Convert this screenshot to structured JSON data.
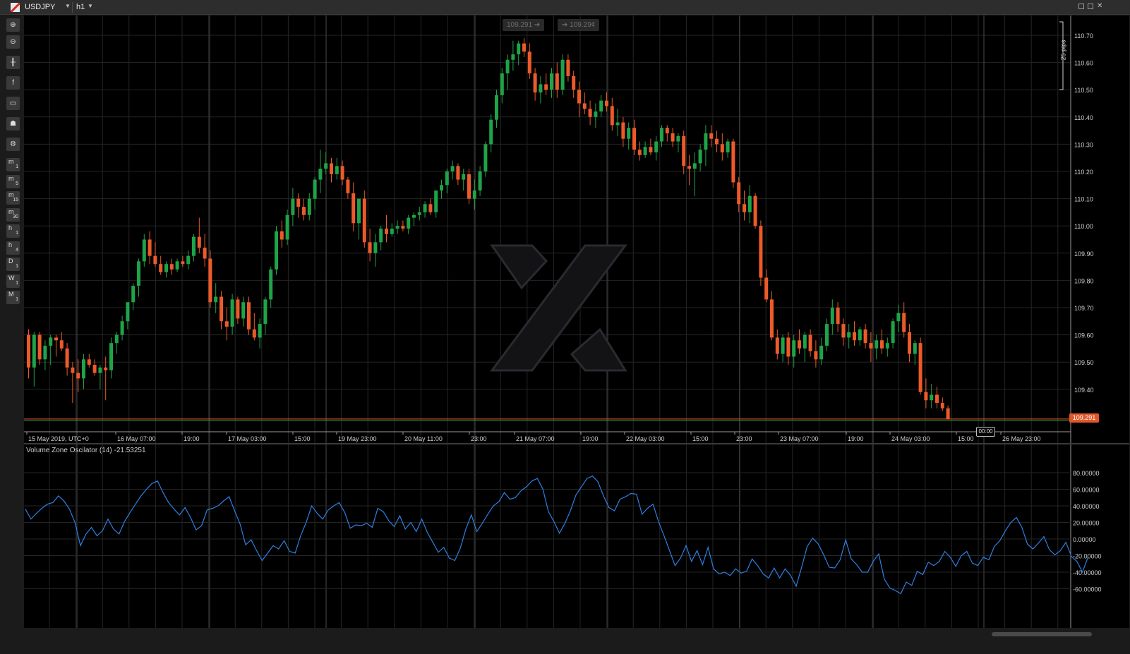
{
  "window": {
    "symbol": "USDJPY",
    "timeframe": "h1"
  },
  "toolbar": {
    "tools": [
      "zoom-in-icon",
      "zoom-out-icon",
      "chart-type-icon",
      "facebook-icon",
      "robot-icon",
      "profile-icon",
      "settings-icon"
    ],
    "timeframes": [
      {
        "l": "m",
        "s": "1"
      },
      {
        "l": "m",
        "s": "5"
      },
      {
        "l": "m",
        "s": "15"
      },
      {
        "l": "m",
        "s": "30"
      },
      {
        "l": "h",
        "s": "1"
      },
      {
        "l": "h",
        "s": "4"
      },
      {
        "l": "D",
        "s": "1"
      },
      {
        "l": "W",
        "s": "1"
      },
      {
        "l": "M",
        "s": "1"
      }
    ]
  },
  "quote": {
    "sell": "109.291",
    "buy": "109.29¢"
  },
  "chart_data": {
    "type": "candlestick",
    "price_axis": [
      "110.70",
      "110.60",
      "110.50",
      "110.40",
      "110.30",
      "110.20",
      "110.10",
      "110.00",
      "109.90",
      "109.80",
      "109.70",
      "109.60",
      "109.50",
      "109.40"
    ],
    "time_axis": [
      "15 May 2019, UTC+0",
      "16 May 07:00",
      "19:00",
      "17 May 03:00",
      "15:00",
      "19 May 23:00",
      "20 May 11:00",
      "23:00",
      "21 May 07:00",
      "19:00",
      "22 May 03:00",
      "15:00",
      "23:00",
      "23 May 07:00",
      "19:00",
      "24 May 03:00",
      "15:00",
      "26 May 23:00"
    ],
    "current_price": "109.291",
    "current_time": "00:00",
    "pips_label": "25 pips",
    "colors": {
      "up": "#1fa348",
      "down": "#ec5a2a",
      "grid": "#252525",
      "osc": "#2e7fe0"
    },
    "ohlc": [
      [
        109.6,
        109.62,
        109.44,
        109.48
      ],
      [
        109.48,
        109.61,
        109.41,
        109.6
      ],
      [
        109.6,
        109.61,
        109.49,
        109.51
      ],
      [
        109.51,
        109.58,
        109.47,
        109.56
      ],
      [
        109.56,
        109.6,
        109.49,
        109.59
      ],
      [
        109.59,
        109.6,
        109.52,
        109.58
      ],
      [
        109.58,
        109.61,
        109.54,
        109.55
      ],
      [
        109.55,
        109.57,
        109.45,
        109.48
      ],
      [
        109.48,
        109.5,
        109.35,
        109.46
      ],
      [
        109.46,
        109.51,
        109.39,
        109.44
      ],
      [
        109.44,
        109.53,
        109.4,
        109.51
      ],
      [
        109.51,
        109.53,
        109.48,
        109.49
      ],
      [
        109.49,
        109.51,
        109.45,
        109.46
      ],
      [
        109.46,
        109.49,
        109.4,
        109.48
      ],
      [
        109.48,
        109.52,
        109.36,
        109.47
      ],
      [
        109.47,
        109.59,
        109.44,
        109.57
      ],
      [
        109.57,
        109.61,
        109.53,
        109.6
      ],
      [
        109.6,
        109.67,
        109.58,
        109.65
      ],
      [
        109.65,
        109.72,
        109.62,
        109.72
      ],
      [
        109.72,
        109.79,
        109.69,
        109.78
      ],
      [
        109.78,
        109.88,
        109.74,
        109.87
      ],
      [
        109.87,
        109.97,
        109.85,
        109.95
      ],
      [
        109.95,
        109.98,
        109.86,
        109.89
      ],
      [
        109.89,
        109.94,
        109.85,
        109.86
      ],
      [
        109.86,
        109.89,
        109.82,
        109.83
      ],
      [
        109.83,
        109.87,
        109.81,
        109.86
      ],
      [
        109.86,
        109.88,
        109.82,
        109.84
      ],
      [
        109.84,
        109.88,
        109.83,
        109.87
      ],
      [
        109.87,
        109.89,
        109.85,
        109.86
      ],
      [
        109.86,
        109.91,
        109.84,
        109.89
      ],
      [
        109.89,
        109.97,
        109.87,
        109.96
      ],
      [
        109.96,
        110.03,
        109.9,
        109.92
      ],
      [
        109.92,
        109.97,
        109.85,
        109.88
      ],
      [
        109.88,
        109.91,
        109.7,
        109.72
      ],
      [
        109.72,
        109.79,
        109.68,
        109.74
      ],
      [
        109.74,
        109.76,
        109.62,
        109.65
      ],
      [
        109.65,
        109.7,
        109.58,
        109.63
      ],
      [
        109.63,
        109.75,
        109.6,
        109.73
      ],
      [
        109.73,
        109.74,
        109.64,
        109.66
      ],
      [
        109.66,
        109.74,
        109.63,
        109.72
      ],
      [
        109.72,
        109.74,
        109.6,
        109.62
      ],
      [
        109.62,
        109.68,
        109.58,
        109.59
      ],
      [
        109.59,
        109.66,
        109.55,
        109.64
      ],
      [
        109.64,
        109.74,
        109.6,
        109.73
      ],
      [
        109.73,
        109.85,
        109.7,
        109.84
      ],
      [
        109.84,
        110.0,
        109.82,
        109.98
      ],
      [
        109.98,
        110.02,
        109.92,
        109.95
      ],
      [
        109.95,
        110.06,
        109.93,
        110.04
      ],
      [
        110.04,
        110.14,
        110.0,
        110.1
      ],
      [
        110.1,
        110.12,
        110.03,
        110.07
      ],
      [
        110.07,
        110.1,
        110.02,
        110.04
      ],
      [
        110.04,
        110.12,
        110.02,
        110.1
      ],
      [
        110.1,
        110.18,
        110.06,
        110.17
      ],
      [
        110.17,
        110.28,
        110.12,
        110.21
      ],
      [
        110.21,
        110.27,
        110.19,
        110.23
      ],
      [
        110.23,
        110.25,
        110.16,
        110.19
      ],
      [
        110.19,
        110.25,
        110.17,
        110.22
      ],
      [
        110.22,
        110.24,
        110.15,
        110.17
      ],
      [
        110.17,
        110.18,
        110.1,
        110.12
      ],
      [
        110.12,
        110.16,
        109.98,
        110.01
      ],
      [
        110.01,
        110.07,
        109.95,
        110.1
      ],
      [
        110.1,
        110.13,
        109.92,
        109.94
      ],
      [
        109.94,
        109.99,
        109.87,
        109.9
      ],
      [
        109.9,
        109.97,
        109.85,
        109.94
      ],
      [
        109.94,
        110.0,
        109.91,
        109.99
      ],
      [
        109.99,
        110.04,
        109.94,
        109.97
      ],
      [
        109.97,
        110.01,
        109.96,
        109.99
      ],
      [
        109.99,
        110.02,
        109.97,
        110.0
      ],
      [
        110.0,
        110.02,
        109.98,
        109.99
      ],
      [
        109.99,
        110.04,
        109.97,
        110.03
      ],
      [
        110.03,
        110.05,
        110.0,
        110.04
      ],
      [
        110.04,
        110.07,
        110.02,
        110.05
      ],
      [
        110.05,
        110.09,
        110.03,
        110.08
      ],
      [
        110.08,
        110.1,
        110.04,
        110.05
      ],
      [
        110.05,
        110.13,
        110.03,
        110.13
      ],
      [
        110.13,
        110.17,
        110.1,
        110.15
      ],
      [
        110.15,
        110.21,
        110.12,
        110.2
      ],
      [
        110.2,
        110.24,
        110.17,
        110.22
      ],
      [
        110.22,
        110.23,
        110.15,
        110.17
      ],
      [
        110.17,
        110.21,
        110.13,
        110.19
      ],
      [
        110.19,
        110.21,
        110.08,
        110.1
      ],
      [
        110.1,
        110.17,
        110.06,
        110.13
      ],
      [
        110.13,
        110.22,
        110.11,
        110.2
      ],
      [
        110.2,
        110.31,
        110.18,
        110.3
      ],
      [
        110.3,
        110.41,
        110.27,
        110.39
      ],
      [
        110.39,
        110.5,
        110.36,
        110.48
      ],
      [
        110.48,
        110.58,
        110.45,
        110.56
      ],
      [
        110.56,
        110.63,
        110.5,
        110.61
      ],
      [
        110.61,
        110.68,
        110.57,
        110.63
      ],
      [
        110.63,
        110.68,
        110.59,
        110.67
      ],
      [
        110.67,
        110.69,
        110.62,
        110.64
      ],
      [
        110.64,
        110.67,
        110.54,
        110.56
      ],
      [
        110.56,
        110.58,
        110.46,
        110.49
      ],
      [
        110.49,
        110.55,
        110.45,
        110.52
      ],
      [
        110.52,
        110.56,
        110.48,
        110.5
      ],
      [
        110.5,
        110.58,
        110.47,
        110.56
      ],
      [
        110.56,
        110.6,
        110.47,
        110.5
      ],
      [
        110.5,
        110.63,
        110.48,
        110.61
      ],
      [
        110.61,
        110.63,
        110.53,
        110.55
      ],
      [
        110.55,
        110.57,
        110.47,
        110.5
      ],
      [
        110.5,
        110.53,
        110.4,
        110.45
      ],
      [
        110.45,
        110.49,
        110.41,
        110.43
      ],
      [
        110.43,
        110.46,
        110.37,
        110.4
      ],
      [
        110.4,
        110.45,
        110.36,
        110.42
      ],
      [
        110.42,
        110.48,
        110.4,
        110.46
      ],
      [
        110.46,
        110.49,
        110.42,
        110.44
      ],
      [
        110.44,
        110.47,
        110.35,
        110.37
      ],
      [
        110.37,
        110.43,
        110.33,
        110.38
      ],
      [
        110.38,
        110.4,
        110.29,
        110.32
      ],
      [
        110.32,
        110.38,
        110.28,
        110.36
      ],
      [
        110.36,
        110.39,
        110.26,
        110.28
      ],
      [
        110.28,
        110.31,
        110.24,
        110.26
      ],
      [
        110.26,
        110.31,
        110.25,
        110.29
      ],
      [
        110.29,
        110.32,
        110.26,
        110.27
      ],
      [
        110.27,
        110.33,
        110.24,
        110.31
      ],
      [
        110.31,
        110.37,
        110.29,
        110.36
      ],
      [
        110.36,
        110.37,
        110.31,
        110.34
      ],
      [
        110.34,
        110.36,
        110.29,
        110.31
      ],
      [
        110.31,
        110.34,
        110.27,
        110.33
      ],
      [
        110.33,
        110.35,
        110.19,
        110.22
      ],
      [
        110.22,
        110.26,
        110.15,
        110.21
      ],
      [
        110.21,
        110.27,
        110.11,
        110.23
      ],
      [
        110.23,
        110.3,
        110.2,
        110.28
      ],
      [
        110.28,
        110.37,
        110.22,
        110.34
      ],
      [
        110.34,
        110.37,
        110.29,
        110.32
      ],
      [
        110.32,
        110.35,
        110.27,
        110.3
      ],
      [
        110.3,
        110.34,
        110.24,
        110.27
      ],
      [
        110.27,
        110.32,
        110.25,
        110.31
      ],
      [
        110.31,
        110.32,
        110.14,
        110.16
      ],
      [
        110.16,
        110.18,
        110.05,
        110.08
      ],
      [
        110.08,
        110.13,
        110.02,
        110.05
      ],
      [
        110.05,
        110.15,
        110.01,
        110.11
      ],
      [
        110.11,
        110.12,
        109.99,
        110.0
      ],
      [
        110.0,
        110.02,
        109.78,
        109.81
      ],
      [
        109.81,
        109.84,
        109.72,
        109.73
      ],
      [
        109.73,
        109.76,
        109.58,
        109.59
      ],
      [
        109.59,
        109.62,
        109.51,
        109.53
      ],
      [
        109.53,
        109.6,
        109.5,
        109.59
      ],
      [
        109.59,
        109.61,
        109.49,
        109.52
      ],
      [
        109.52,
        109.6,
        109.48,
        109.58
      ],
      [
        109.58,
        109.62,
        109.53,
        109.55
      ],
      [
        109.55,
        109.61,
        109.5,
        109.6
      ],
      [
        109.6,
        109.62,
        109.52,
        109.54
      ],
      [
        109.54,
        109.58,
        109.48,
        109.51
      ],
      [
        109.51,
        109.59,
        109.49,
        109.56
      ],
      [
        109.56,
        109.66,
        109.54,
        109.64
      ],
      [
        109.64,
        109.73,
        109.6,
        109.7
      ],
      [
        109.7,
        109.72,
        109.61,
        109.64
      ],
      [
        109.64,
        109.66,
        109.56,
        109.59
      ],
      [
        109.59,
        109.64,
        109.55,
        109.61
      ],
      [
        109.61,
        109.65,
        109.56,
        109.58
      ],
      [
        109.58,
        109.63,
        109.56,
        109.62
      ],
      [
        109.62,
        109.64,
        109.55,
        109.57
      ],
      [
        109.57,
        109.61,
        109.5,
        109.55
      ],
      [
        109.55,
        109.6,
        109.51,
        109.58
      ],
      [
        109.58,
        109.62,
        109.53,
        109.55
      ],
      [
        109.55,
        109.59,
        109.52,
        109.57
      ],
      [
        109.57,
        109.66,
        109.55,
        109.65
      ],
      [
        109.65,
        109.71,
        109.61,
        109.68
      ],
      [
        109.68,
        109.72,
        109.59,
        109.61
      ],
      [
        109.61,
        109.64,
        109.5,
        109.53
      ],
      [
        109.53,
        109.58,
        109.49,
        109.57
      ],
      [
        109.57,
        109.59,
        109.38,
        109.39
      ],
      [
        109.39,
        109.44,
        109.33,
        109.36
      ],
      [
        109.36,
        109.42,
        109.33,
        109.38
      ],
      [
        109.38,
        109.41,
        109.33,
        109.35
      ],
      [
        109.35,
        109.37,
        109.32,
        109.33
      ],
      [
        109.33,
        109.34,
        109.29,
        109.29
      ]
    ],
    "oscillator": {
      "label": "Volume Zone Oscilator (14) -21.53251",
      "axis": [
        "80.00000",
        "60.00000",
        "40.00000",
        "20.00000",
        "0.00000",
        "-20.00000",
        "-40.00000",
        "-60.00000"
      ],
      "values": [
        36,
        24,
        31,
        37,
        42,
        44,
        52,
        46,
        36,
        20,
        -8,
        6,
        14,
        4,
        10,
        24,
        12,
        6,
        21,
        32,
        42,
        52,
        60,
        67,
        70,
        56,
        44,
        36,
        29,
        38,
        26,
        11,
        16,
        35,
        37,
        40,
        46,
        51,
        34,
        18,
        -7,
        -1,
        -14,
        -26,
        -17,
        -8,
        -12,
        -2,
        -15,
        -17,
        4,
        20,
        40,
        31,
        24,
        35,
        40,
        44,
        32,
        13,
        17,
        16,
        19,
        14,
        37,
        33,
        22,
        15,
        28,
        12,
        20,
        9,
        24,
        8,
        -4,
        -16,
        -10,
        -23,
        -26,
        -11,
        12,
        29,
        9,
        19,
        30,
        40,
        45,
        56,
        48,
        50,
        58,
        63,
        70,
        73,
        60,
        33,
        21,
        7,
        19,
        34,
        53,
        63,
        73,
        76,
        69,
        52,
        38,
        34,
        48,
        51,
        55,
        54,
        30,
        37,
        42,
        21,
        4,
        -14,
        -32,
        -23,
        -8,
        -27,
        -14,
        -31,
        -10,
        -36,
        -42,
        -40,
        -44,
        -36,
        -41,
        -39,
        -24,
        -32,
        -42,
        -47,
        -35,
        -47,
        -36,
        -44,
        -57,
        -34,
        -9,
        1,
        -6,
        -19,
        -34,
        -35,
        -25,
        -1,
        -24,
        -31,
        -40,
        -40,
        -27,
        -18,
        -48,
        -59,
        -62,
        -66,
        -52,
        -56,
        -39,
        -43,
        -28,
        -32,
        -27,
        -15,
        -22,
        -33,
        -20,
        -15,
        -29,
        -32,
        -22,
        -25,
        -9,
        -2,
        10,
        20,
        26,
        14,
        -6,
        -12,
        -5,
        3,
        -13,
        -19,
        -14,
        -4,
        -21,
        -27,
        -40,
        -22
      ]
    }
  }
}
